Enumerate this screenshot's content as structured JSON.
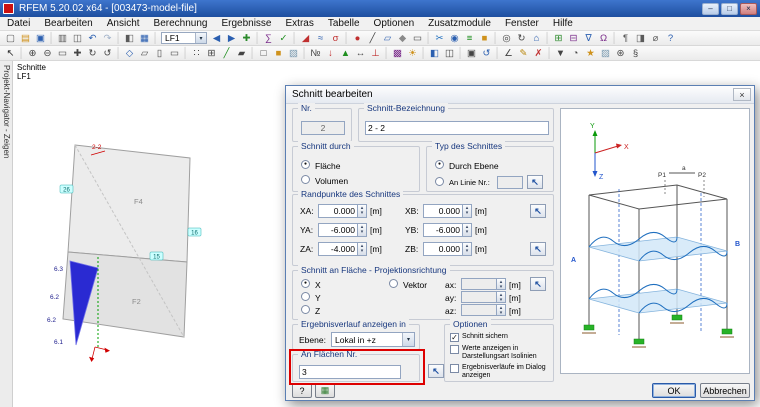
{
  "window": {
    "title": "RFEM 5.20.02 x64 - [003473-model-file]",
    "controls": {
      "minimize": "–",
      "maximize": "□",
      "close": "×"
    }
  },
  "menubar": {
    "items": [
      {
        "n": "menu-datei",
        "label": "Datei"
      },
      {
        "n": "menu-bearbeiten",
        "label": "Bearbeiten"
      },
      {
        "n": "menu-ansicht",
        "label": "Ansicht"
      },
      {
        "n": "menu-berechnung",
        "label": "Berechnung"
      },
      {
        "n": "menu-ergebnisse",
        "label": "Ergebnisse"
      },
      {
        "n": "menu-extras",
        "label": "Extras"
      },
      {
        "n": "menu-tabelle",
        "label": "Tabelle"
      },
      {
        "n": "menu-optionen",
        "label": "Optionen"
      },
      {
        "n": "menu-zusatzmodule",
        "label": "Zusatzmodule"
      },
      {
        "n": "menu-fenster",
        "label": "Fenster"
      },
      {
        "n": "menu-hilfe",
        "label": "Hilfe"
      }
    ]
  },
  "toolbar_main": {
    "icons_left": [
      {
        "n": "new-file-icon",
        "g": "▢",
        "c": "#5a5a5a"
      },
      {
        "n": "open-icon",
        "g": "▤",
        "c": "#cf921c"
      },
      {
        "n": "save-icon",
        "g": "▣",
        "c": "#2b5fb0"
      },
      {
        "n": "separator",
        "g": "│",
        "c": "#c6c6c6",
        "i": "false"
      },
      {
        "n": "print-icon",
        "g": "▥",
        "c": "#5a5a5a"
      },
      {
        "n": "copy-icon",
        "g": "◫",
        "c": "#5a5a5a"
      },
      {
        "n": "undo-icon",
        "g": "↶",
        "c": "#2b5fb0"
      },
      {
        "n": "redo-icon",
        "g": "↷",
        "c": "#9fb0c8"
      },
      {
        "n": "separator",
        "g": "│",
        "c": "#c6c6c6",
        "i": "false"
      },
      {
        "n": "navigator-toggle-icon",
        "g": "◧",
        "c": "#5a5a5a"
      },
      {
        "n": "tables-toggle-icon",
        "g": "▦",
        "c": "#2b5fb0"
      },
      {
        "n": "separator",
        "g": "│",
        "c": "#c6c6c6",
        "i": "false"
      }
    ],
    "load_case": {
      "value": "LF1"
    },
    "icons_right": [
      {
        "n": "prev-load-case-icon",
        "g": "◀",
        "c": "#2b5fb0"
      },
      {
        "n": "next-load-case-icon",
        "g": "▶",
        "c": "#2b5fb0"
      },
      {
        "n": "new-load-case-icon",
        "g": "✚",
        "c": "#2b8a2b"
      },
      {
        "n": "separator",
        "g": "│",
        "c": "#c6c6c6",
        "i": "false"
      },
      {
        "n": "calculation-icon",
        "g": "∑",
        "c": "#7a2b8a"
      },
      {
        "n": "check-model-icon",
        "g": "✓",
        "c": "#1f8f1f"
      },
      {
        "n": "separator",
        "g": "│",
        "c": "#c6c6c6",
        "i": "false"
      },
      {
        "n": "results-toggle-icon",
        "g": "◢",
        "c": "#c03030"
      },
      {
        "n": "deformation-icon",
        "g": "≈",
        "c": "#2b5fb0"
      },
      {
        "n": "internal-forces-icon",
        "g": "σ",
        "c": "#c03030"
      },
      {
        "n": "separator",
        "g": "│",
        "c": "#c6c6c6",
        "i": "false"
      },
      {
        "n": "new-node-icon",
        "g": "●",
        "c": "#c03030"
      },
      {
        "n": "new-line-icon",
        "g": "╱",
        "c": "#444444"
      },
      {
        "n": "new-surface-icon",
        "g": "▱",
        "c": "#2b5fb0"
      },
      {
        "n": "new-solid-icon",
        "g": "◆",
        "c": "#8a8a8a"
      },
      {
        "n": "new-opening-icon",
        "g": "▭",
        "c": "#444444"
      },
      {
        "n": "separator",
        "g": "│",
        "c": "#c6c6c6",
        "i": "false"
      },
      {
        "n": "new-section-icon",
        "g": "✂",
        "c": "#1f6fbf"
      },
      {
        "n": "visibility-icon",
        "g": "◉",
        "c": "#2b5fb0"
      },
      {
        "n": "isolines-icon",
        "g": "≡",
        "c": "#1f8f1f"
      },
      {
        "n": "render-icon",
        "g": "■",
        "c": "#cf921c"
      },
      {
        "n": "separator",
        "g": "│",
        "c": "#c6c6c6",
        "i": "false"
      },
      {
        "n": "zoom-icon",
        "g": "◎",
        "c": "#444444"
      },
      {
        "n": "rotate-view-icon",
        "g": "↻",
        "c": "#444444"
      },
      {
        "n": "show-all-icon",
        "g": "⌂",
        "c": "#2b5fb0"
      },
      {
        "n": "separator",
        "g": "│",
        "c": "#c6c6c6",
        "i": "false"
      },
      {
        "n": "load-cases-icon",
        "g": "⊞",
        "c": "#2b8a2b"
      },
      {
        "n": "combinations-icon",
        "g": "⊟",
        "c": "#7a2b8a"
      },
      {
        "n": "generate-icon",
        "g": "∇",
        "c": "#2b5fb0"
      },
      {
        "n": "modules-icon",
        "g": "Ω",
        "c": "#7a2b8a"
      },
      {
        "n": "separator",
        "g": "│",
        "c": "#c6c6c6",
        "i": "false"
      },
      {
        "n": "printout-report-icon",
        "g": "¶",
        "c": "#5a5a5a"
      },
      {
        "n": "panel-toggle-icon",
        "g": "◨",
        "c": "#5a5a5a"
      },
      {
        "n": "units-icon",
        "g": "⌀",
        "c": "#5a5a5a"
      },
      {
        "n": "help-icon",
        "g": "?",
        "c": "#2b5fb0"
      }
    ]
  },
  "toolbar_view": {
    "icons": [
      {
        "n": "select-icon",
        "g": "↖",
        "c": "#222222"
      },
      {
        "n": "separator",
        "g": "│",
        "c": "#c6c6c6",
        "i": "false"
      },
      {
        "n": "zoom-in-icon",
        "g": "⊕",
        "c": "#444444"
      },
      {
        "n": "zoom-out-icon",
        "g": "⊖",
        "c": "#444444"
      },
      {
        "n": "zoom-window-icon",
        "g": "▭",
        "c": "#444444"
      },
      {
        "n": "pan-icon",
        "g": "✚",
        "c": "#444444"
      },
      {
        "n": "rotate-icon",
        "g": "↻",
        "c": "#444444"
      },
      {
        "n": "previous-view-icon",
        "g": "↺",
        "c": "#444444"
      },
      {
        "n": "separator",
        "g": "│",
        "c": "#c6c6c6",
        "i": "false"
      },
      {
        "n": "isometric-view-icon",
        "g": "◇",
        "c": "#2b5fb0"
      },
      {
        "n": "view-xy-icon",
        "g": "▱",
        "c": "#444444"
      },
      {
        "n": "view-xz-icon",
        "g": "▯",
        "c": "#444444"
      },
      {
        "n": "view-yz-icon",
        "g": "▭",
        "c": "#444444"
      },
      {
        "n": "separator",
        "g": "│",
        "c": "#c6c6c6",
        "i": "false"
      },
      {
        "n": "grid-icon",
        "g": "∷",
        "c": "#444444"
      },
      {
        "n": "snap-icon",
        "g": "⊞",
        "c": "#444444"
      },
      {
        "n": "guidelines-icon",
        "g": "╱",
        "c": "#1f8f1f"
      },
      {
        "n": "work-plane-icon",
        "g": "▰",
        "c": "#444444"
      },
      {
        "n": "separator",
        "g": "│",
        "c": "#c6c6c6",
        "i": "false"
      },
      {
        "n": "wireframe-icon",
        "g": "□",
        "c": "#444444"
      },
      {
        "n": "solid-render-icon",
        "g": "■",
        "c": "#cf921c"
      },
      {
        "n": "transparent-render-icon",
        "g": "▧",
        "c": "#7a9ab0"
      },
      {
        "n": "separator",
        "g": "│",
        "c": "#c6c6c6",
        "i": "false"
      },
      {
        "n": "numbering-icon",
        "g": "№",
        "c": "#444444"
      },
      {
        "n": "show-loads-icon",
        "g": "↓",
        "c": "#c03030"
      },
      {
        "n": "show-supports-icon",
        "g": "▲",
        "c": "#1f8f1f"
      },
      {
        "n": "show-dimensions-icon",
        "g": "↔",
        "c": "#444444"
      },
      {
        "n": "show-axes-icon",
        "g": "⊥",
        "c": "#c03030"
      },
      {
        "n": "separator",
        "g": "│",
        "c": "#c6c6c6",
        "i": "false"
      },
      {
        "n": "display-properties-icon",
        "g": "▩",
        "c": "#7a2b8a"
      },
      {
        "n": "light-icon",
        "g": "☀",
        "c": "#cf921c"
      },
      {
        "n": "separator",
        "g": "│",
        "c": "#c6c6c6",
        "i": "false"
      },
      {
        "n": "clipping-plane-icon",
        "g": "◧",
        "c": "#2b5fb0"
      },
      {
        "n": "margins-icon",
        "g": "◫",
        "c": "#444444"
      },
      {
        "n": "separator",
        "g": "│",
        "c": "#c6c6c6",
        "i": "false"
      },
      {
        "n": "new-window-icon",
        "g": "▣",
        "c": "#444444"
      },
      {
        "n": "refresh-icon",
        "g": "↺",
        "c": "#2b5fb0"
      },
      {
        "n": "separator",
        "g": "│",
        "c": "#c6c6c6",
        "i": "false"
      },
      {
        "n": "measure-icon",
        "g": "∠",
        "c": "#444444"
      },
      {
        "n": "comment-icon",
        "g": "✎",
        "c": "#b8860b"
      },
      {
        "n": "delete-icon",
        "g": "✗",
        "c": "#c03030"
      },
      {
        "n": "separator",
        "g": "│",
        "c": "#c6c6c6",
        "i": "false"
      },
      {
        "n": "filter-icon",
        "g": "▼",
        "c": "#444444"
      },
      {
        "n": "partial-view-icon",
        "g": "◔",
        "c": "#444444"
      },
      {
        "n": "user-view-icon",
        "g": "★",
        "c": "#cf921c"
      },
      {
        "n": "background-icon",
        "g": "▨",
        "c": "#7a9ab0"
      },
      {
        "n": "settings-icon",
        "g": "⊛",
        "c": "#444444"
      },
      {
        "n": "info-icon",
        "g": "§",
        "c": "#444444"
      }
    ]
  },
  "navigator": {
    "tab_label": "Projekt-Navigator - Zeigen"
  },
  "canvas": {
    "header_title": "Schnitte",
    "header_case": "LF1",
    "section_label": "2-2",
    "surface_labels": [
      "F4",
      "F2"
    ],
    "node_labels": [
      "26",
      "16",
      "15"
    ],
    "result_values": [
      "6.3",
      "6.2",
      "6.2",
      "6.1"
    ]
  },
  "dialog": {
    "title": "Schnitt bearbeiten",
    "close": "×",
    "nr": {
      "label": "Nr.",
      "value": "2"
    },
    "bezeichnung": {
      "label": "Schnitt-Bezeichnung",
      "value": "2 - 2"
    },
    "schnitt_durch": {
      "title": "Schnitt durch",
      "options": [
        {
          "label": "Fläche",
          "dot": "●"
        },
        {
          "label": "Volumen",
          "dot": ""
        }
      ]
    },
    "typ": {
      "title": "Typ des Schnittes",
      "ebene_label": "Durch Ebene",
      "ebene_dot": "●",
      "linie_label": "An Linie Nr.:",
      "linie_dot": "",
      "linie_value": ""
    },
    "randpunkte": {
      "title": "Randpunkte des Schnittes",
      "rows": [
        {
          "la": "XA:",
          "va": "0.000",
          "lb": "XB:",
          "vb": "0.000",
          "u": "[m]"
        },
        {
          "la": "YA:",
          "va": "-6.000",
          "lb": "YB:",
          "vb": "-6.000",
          "u": "[m]"
        },
        {
          "la": "ZA:",
          "va": "-4.000",
          "lb": "ZB:",
          "vb": "0.000",
          "u": "[m]"
        }
      ]
    },
    "projektion": {
      "title": "Schnitt an Fläche - Projektionsrichtung",
      "axes": [
        {
          "label": "X",
          "dot": "●"
        },
        {
          "label": "Y",
          "dot": ""
        },
        {
          "label": "Z",
          "dot": ""
        }
      ],
      "vektor_label": "Vektor",
      "vektor_dot": "",
      "components": [
        {
          "label": "ax:",
          "u": "[m]"
        },
        {
          "label": "ay:",
          "u": "[m]"
        },
        {
          "label": "az:",
          "u": "[m]"
        }
      ]
    },
    "ergebnisverlauf": {
      "title": "Ergebnisverlauf anzeigen in",
      "ebene_label": "Ebene:",
      "ebene_value": "Lokal in +z"
    },
    "an_flaechen": {
      "title": "An Flächen Nr.",
      "value": "3"
    },
    "optionen": {
      "title": "Optionen",
      "items": [
        {
          "label": "Schnitt sichern",
          "mark": "✓"
        },
        {
          "label": "Werte anzeigen in Darstellungsart Isolinien",
          "mark": ""
        },
        {
          "label": "Ergebnisverläufe im Dialog anzeigen",
          "mark": ""
        }
      ]
    },
    "illustration": {
      "x": "X",
      "y": "Y",
      "z": "Z",
      "p1": "P1",
      "p2": "P2",
      "a": "a",
      "A": "A",
      "B": "B"
    },
    "footer": {
      "help": "?",
      "graphic": "▦",
      "ok": "OK",
      "cancel": "Abbrechen"
    }
  }
}
